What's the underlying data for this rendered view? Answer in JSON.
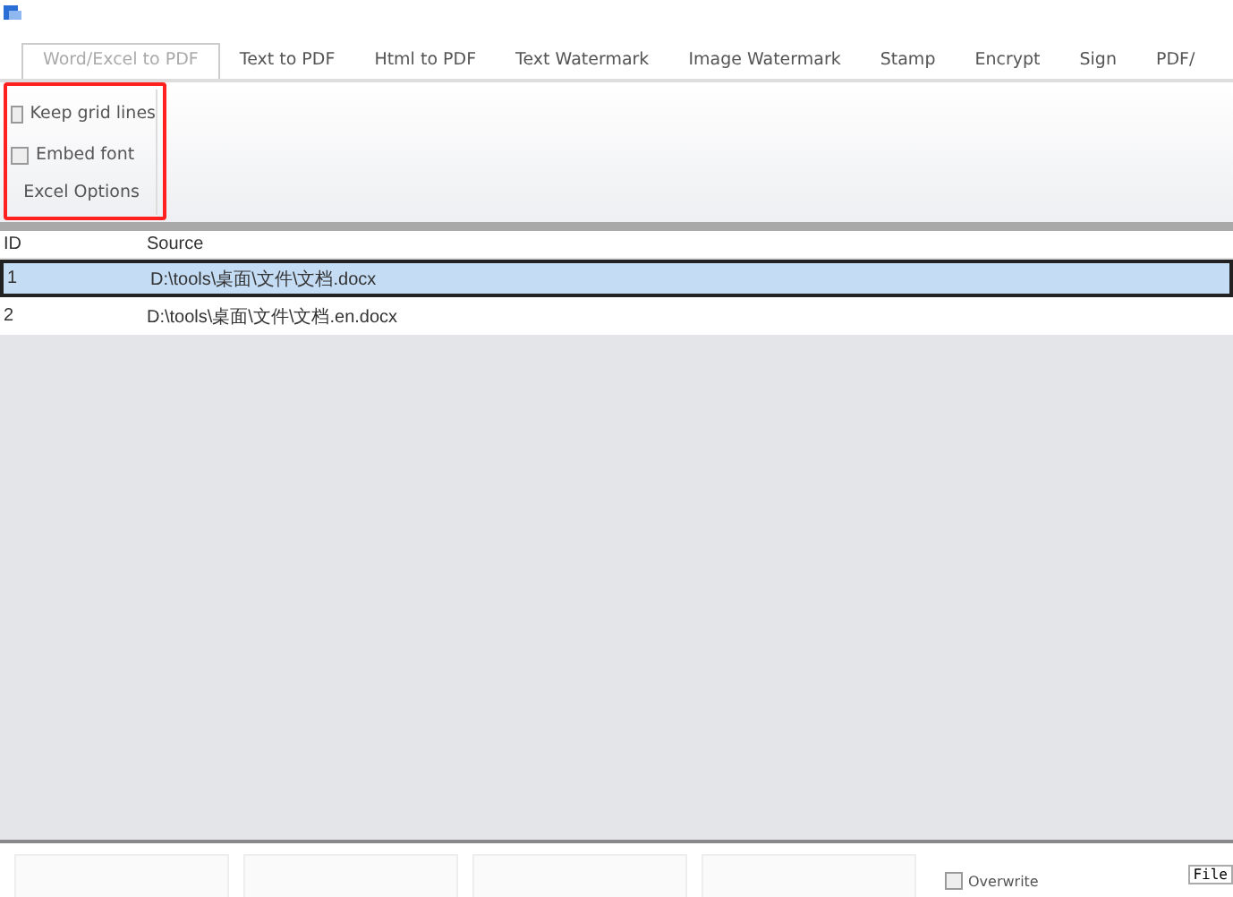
{
  "tabs": [
    {
      "label": "Word/Excel to PDF",
      "selected": true
    },
    {
      "label": "Text to PDF",
      "selected": false
    },
    {
      "label": "Html to PDF",
      "selected": false
    },
    {
      "label": "Text Watermark",
      "selected": false
    },
    {
      "label": "Image Watermark",
      "selected": false
    },
    {
      "label": "Stamp",
      "selected": false
    },
    {
      "label": "Encrypt",
      "selected": false
    },
    {
      "label": "Sign",
      "selected": false
    },
    {
      "label": "PDF/",
      "selected": false
    }
  ],
  "excel_options": {
    "title": "Excel Options",
    "options": [
      {
        "label": "Keep grid lines",
        "checked": false
      },
      {
        "label": "Embed font",
        "checked": false
      }
    ]
  },
  "table": {
    "columns": [
      "ID",
      "Source"
    ],
    "rows": [
      {
        "cells": [
          "1",
          "D:\\tools\\桌面\\文件\\文档.docx"
        ],
        "selected": true
      },
      {
        "cells": [
          "2",
          "D:\\tools\\桌面\\文件\\文档.en.docx"
        ],
        "selected": false
      }
    ]
  },
  "bottom": {
    "overwrite": {
      "label": "Overwrite",
      "checked": false
    },
    "file_button": "File"
  }
}
